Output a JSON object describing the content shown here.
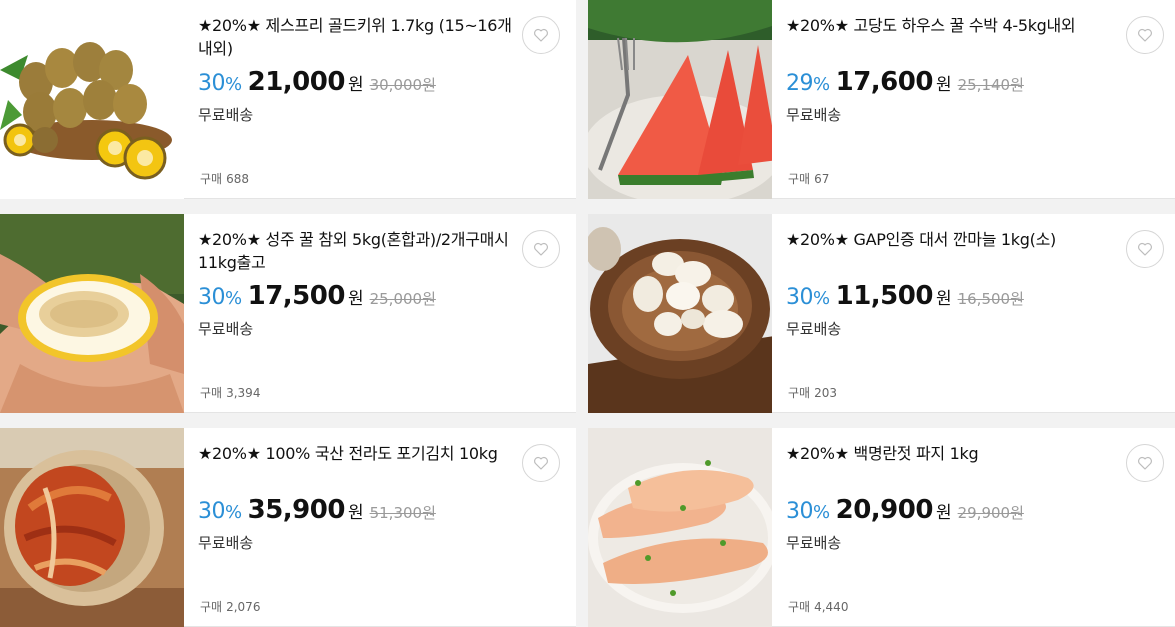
{
  "products": [
    {
      "title": "★20%★ 제스프리 골드키위 1.7kg (15~16개 내외)",
      "discount": "30",
      "discount_unit": "%",
      "price": "21,000",
      "currency": "원",
      "original_price": "30,000원",
      "shipping": "무료배송",
      "buy_label": "구매",
      "buy_count": "688",
      "image": "kiwi-image"
    },
    {
      "title": "★20%★ 고당도 하우스 꿀 수박 4-5kg내외",
      "discount": "29",
      "discount_unit": "%",
      "price": "17,600",
      "currency": "원",
      "original_price": "25,140원",
      "shipping": "무료배송",
      "buy_label": "구매",
      "buy_count": "67",
      "image": "watermelon-image"
    },
    {
      "title": "★20%★ 성주 꿀 참외 5kg(혼합과)/2개구매시 11kg출고",
      "discount": "30",
      "discount_unit": "%",
      "price": "17,500",
      "currency": "원",
      "original_price": "25,000원",
      "shipping": "무료배송",
      "buy_label": "구매",
      "buy_count": "3,394",
      "image": "korean-melon-image"
    },
    {
      "title": "★20%★ GAP인증 대서 깐마늘 1kg(소)",
      "discount": "30",
      "discount_unit": "%",
      "price": "11,500",
      "currency": "원",
      "original_price": "16,500원",
      "shipping": "무료배송",
      "buy_label": "구매",
      "buy_count": "203",
      "image": "garlic-image"
    },
    {
      "title": "★20%★ 100% 국산 전라도 포기김치 10kg",
      "discount": "30",
      "discount_unit": "%",
      "price": "35,900",
      "currency": "원",
      "original_price": "51,300원",
      "shipping": "무료배송",
      "buy_label": "구매",
      "buy_count": "2,076",
      "image": "kimchi-image"
    },
    {
      "title": "★20%★ 백명란젓 파지 1kg",
      "discount": "30",
      "discount_unit": "%",
      "price": "20,900",
      "currency": "원",
      "original_price": "29,900원",
      "shipping": "무료배송",
      "buy_label": "구매",
      "buy_count": "4,440",
      "image": "pollock-roe-image"
    }
  ],
  "colors": {
    "discount": "#2b8fd6",
    "page_bg": "#f2f2f2",
    "card_bg": "#ffffff"
  },
  "icons": {
    "wishlist": "heart-icon"
  }
}
